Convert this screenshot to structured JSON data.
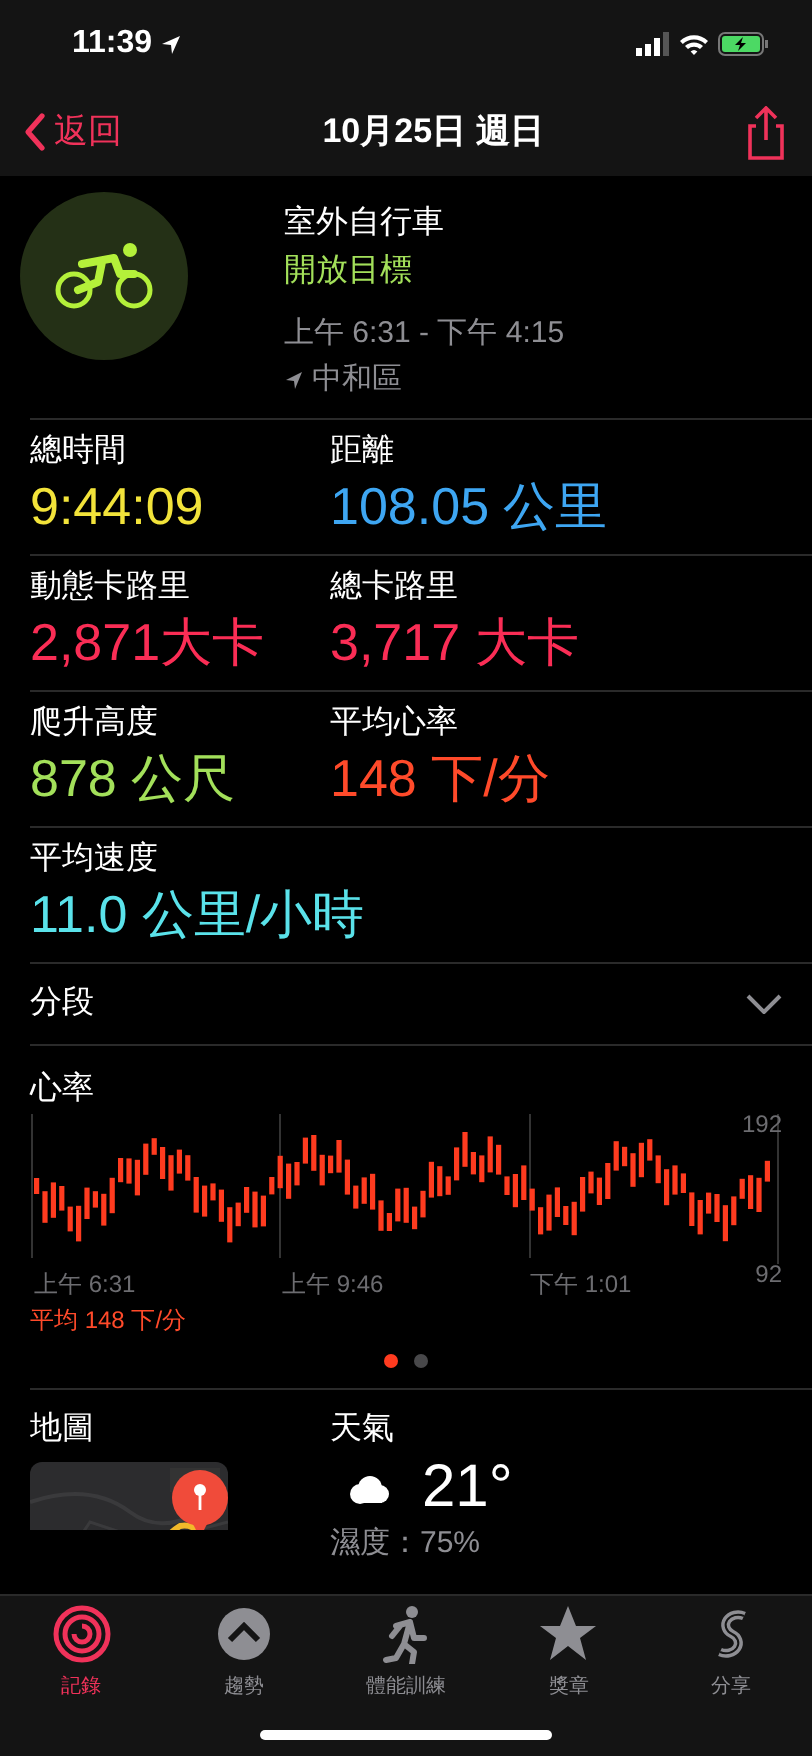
{
  "status_bar": {
    "time": "11:39"
  },
  "nav": {
    "back": "返回",
    "title": "10月25日 週日"
  },
  "workout": {
    "title": "室外自行車",
    "goal": "開放目標",
    "time_range": "上午 6:31 - 下午 4:15",
    "location": "中和區"
  },
  "stats": [
    {
      "label": "總時間",
      "value": "9:44:09",
      "color": "#f2e33a"
    },
    {
      "label": "距離",
      "value": "108.05 公里",
      "color": "#3ea6f2"
    },
    {
      "label": "動態卡路里",
      "value": "2,871大卡",
      "color": "#fa2d55"
    },
    {
      "label": "總卡路里",
      "value": "3,717 大卡",
      "color": "#fa2d55"
    },
    {
      "label": "爬升高度",
      "value": "878 公尺",
      "color": "#a3e05a"
    },
    {
      "label": "平均心率",
      "value": "148 下/分",
      "color": "#ff4a2a"
    },
    {
      "label": "平均速度",
      "value": "11.0 公里/小時",
      "color": "#5ae2ea"
    }
  ],
  "splits": {
    "label": "分段",
    "expanded": false
  },
  "heart_rate": {
    "title": "心率",
    "y_labels": [
      "192",
      "92"
    ],
    "x_labels": [
      "上午 6:31",
      "上午 9:46",
      "下午 1:01"
    ],
    "average": "平均 148 下/分"
  },
  "page_dots": [
    {
      "selected": true
    },
    {
      "selected": false
    }
  ],
  "map": {
    "title": "地圖",
    "kind": "picture"
  },
  "weather": {
    "title": "天氣",
    "temperature": "21°",
    "humidity": "濕度：75%"
  },
  "tabs": [
    {
      "label": "記錄",
      "selected": true
    },
    {
      "label": "趨勢",
      "selected": false
    },
    {
      "label": "體能訓練",
      "selected": false
    },
    {
      "label": "獎章",
      "selected": false
    },
    {
      "label": "分享",
      "selected": false
    }
  ]
}
